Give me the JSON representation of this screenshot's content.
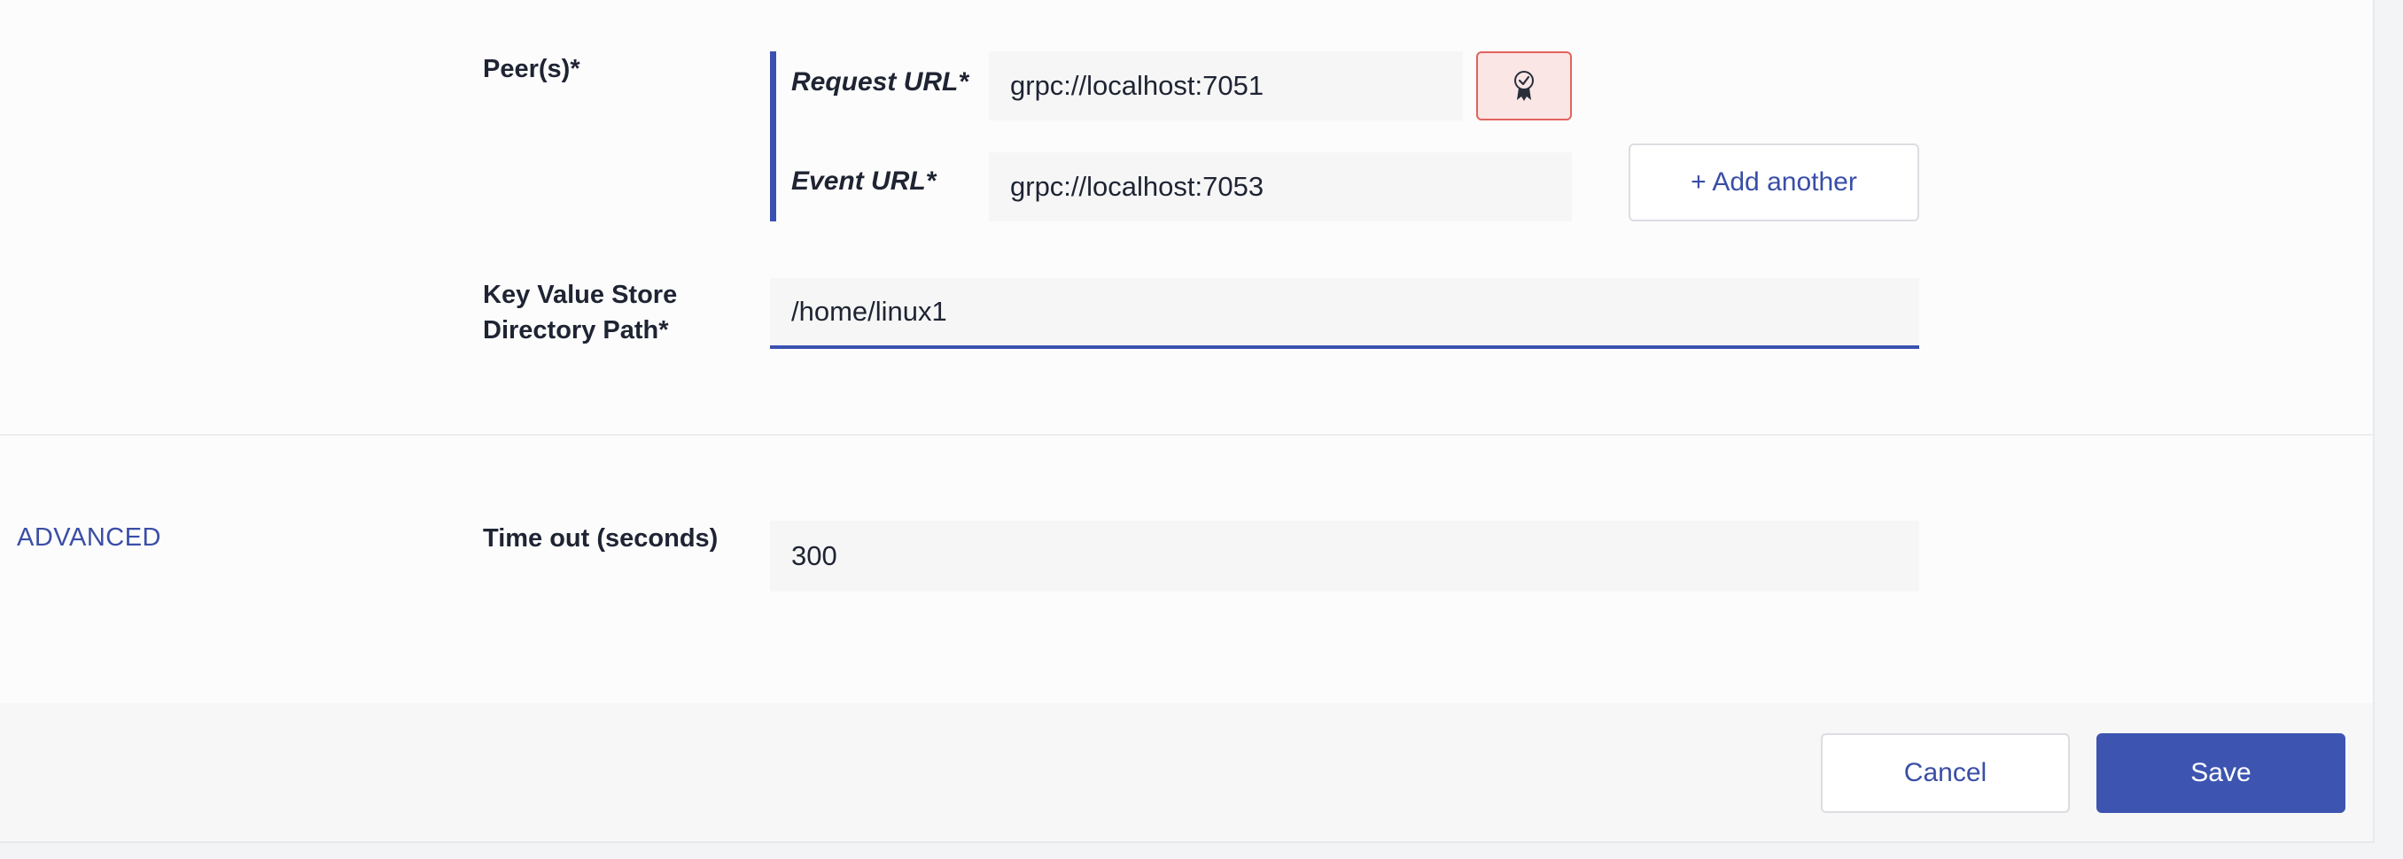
{
  "form": {
    "peers": {
      "label": "Peer(s)*",
      "request_url_label": "Request URL*",
      "request_url_value": "grpc://localhost:7051",
      "event_url_label": "Event URL*",
      "event_url_value": "grpc://localhost:7053",
      "certificate_button_icon": "certificate-ribbon-icon",
      "add_another_label": "+ Add another"
    },
    "key_value_store": {
      "label_line1": "Key Value Store",
      "label_line2": "Directory Path*",
      "value": "/home/linux1"
    }
  },
  "advanced": {
    "section_label": "ADVANCED",
    "timeout_label": "Time out (seconds)",
    "timeout_value": "300"
  },
  "footer": {
    "cancel_label": "Cancel",
    "save_label": "Save"
  },
  "colors": {
    "accent": "#3d55b1",
    "error_border": "#e2635d",
    "error_fill": "#fbe6e6"
  }
}
